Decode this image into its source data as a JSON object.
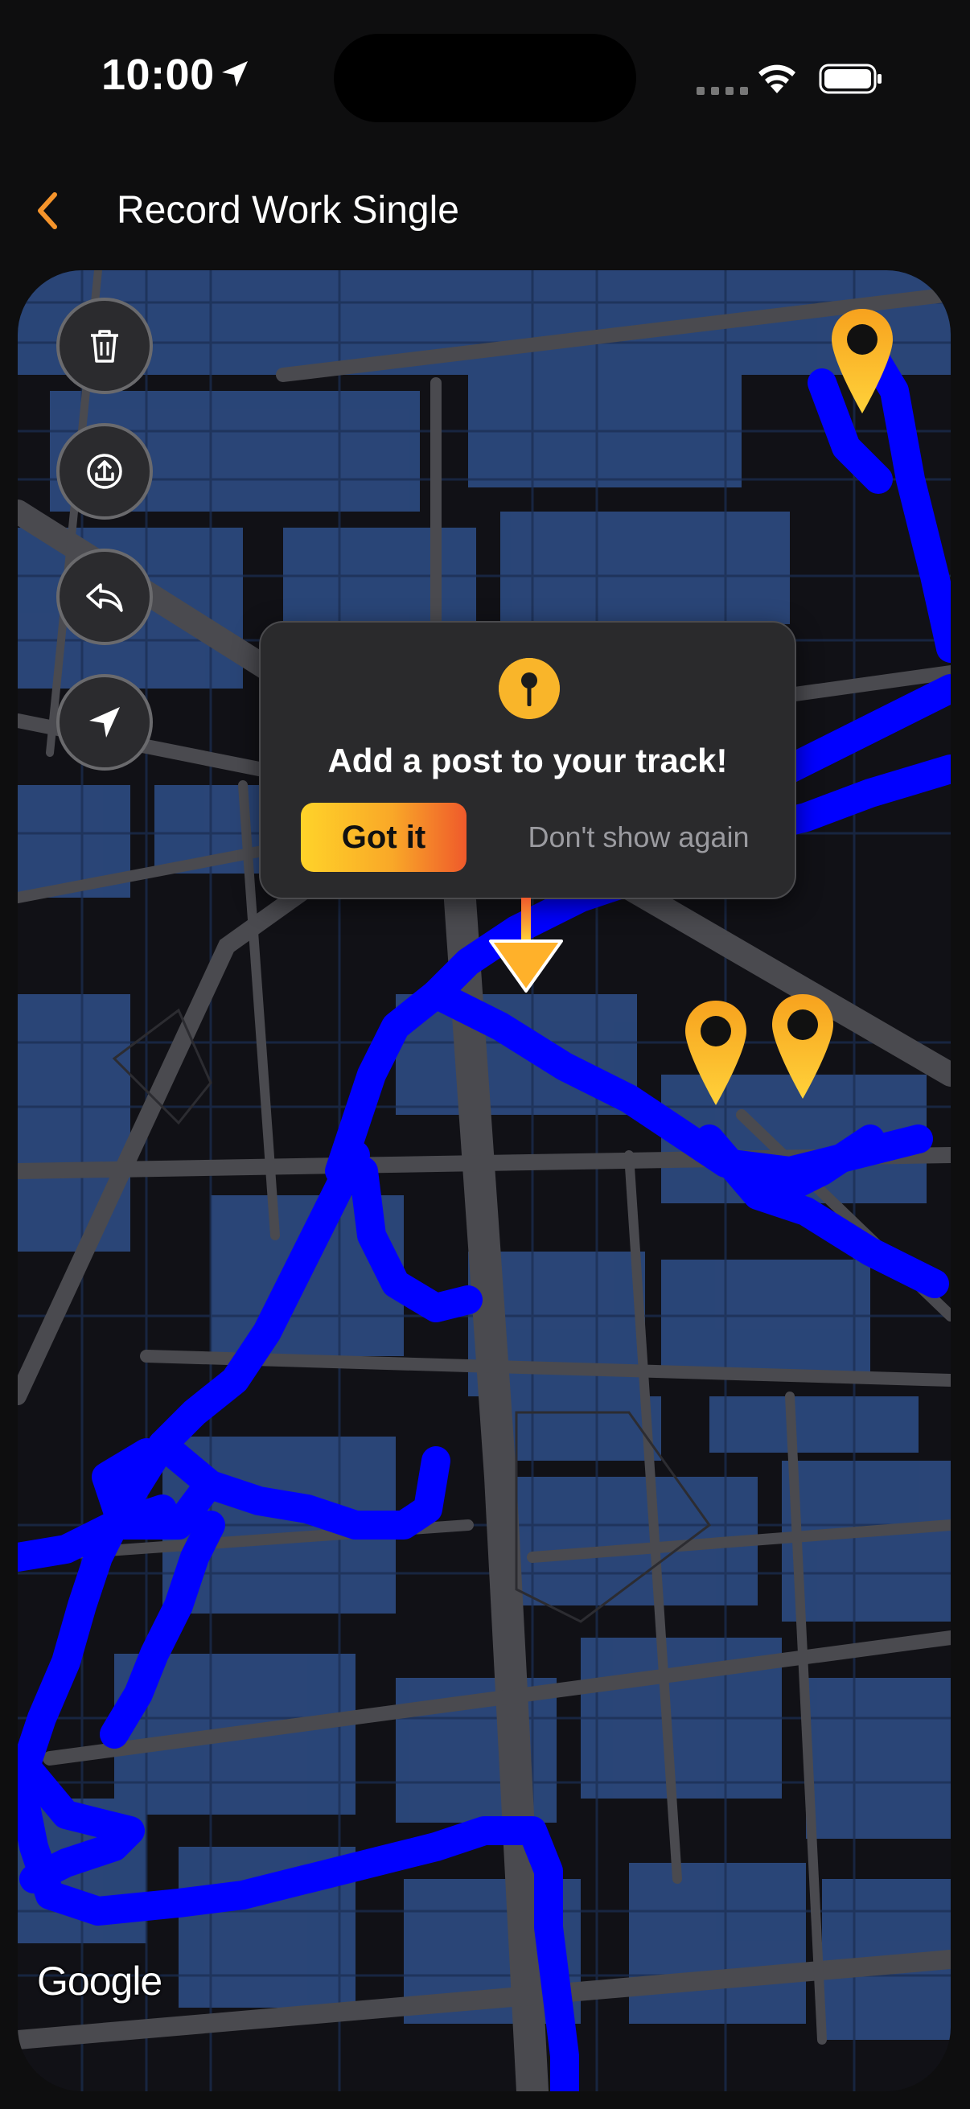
{
  "status_bar": {
    "time": "10:00"
  },
  "nav": {
    "title": "Record Work Single",
    "back_icon": "chevron-left-icon",
    "accent_color": "#f5942b"
  },
  "map": {
    "attribution": "Google",
    "route_color": "#0000ff",
    "pin_color": "#f7a626"
  },
  "map_controls": [
    {
      "name": "delete-button",
      "icon": "trash-icon"
    },
    {
      "name": "share-button",
      "icon": "share-icon"
    },
    {
      "name": "undo-button",
      "icon": "reply-icon"
    },
    {
      "name": "locate-button",
      "icon": "navigation-arrow-icon"
    }
  ],
  "tooltip": {
    "icon": "pin-icon",
    "title": "Add a post to your track!",
    "primary_label": "Got it",
    "secondary_label": "Don't show again"
  }
}
